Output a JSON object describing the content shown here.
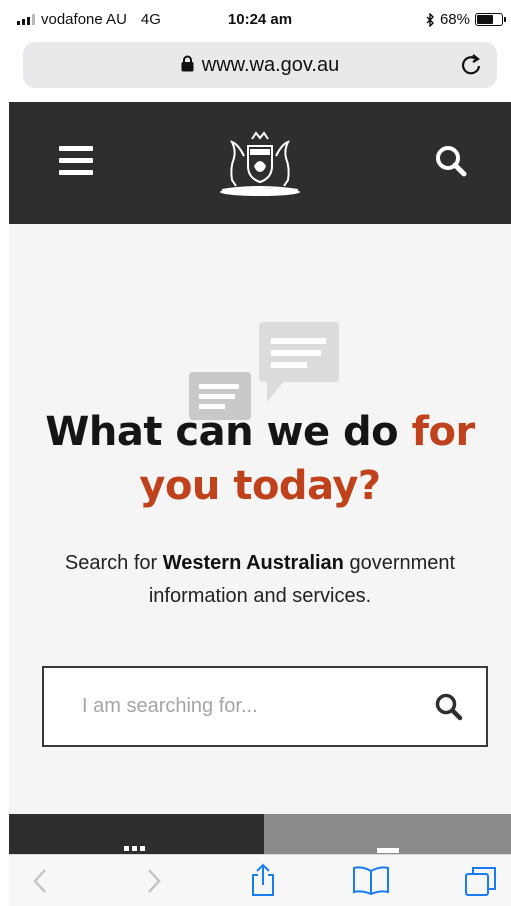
{
  "status_bar": {
    "carrier": "vodafone AU",
    "network": "4G",
    "time": "10:24 am",
    "battery_percent": "68%",
    "battery_level": 0.68
  },
  "browser": {
    "url": "www.wa.gov.au"
  },
  "hero": {
    "headline_part1": "What can we do ",
    "headline_part2": "for you today?",
    "subtext_before": "Search for ",
    "subtext_bold": "Western Australian",
    "subtext_after": " government information and services."
  },
  "search": {
    "placeholder": "I am searching for..."
  },
  "colors": {
    "header_bg": "#2e2e2e",
    "accent": "#c0421c",
    "page_bg": "#f5f5f5",
    "ios_blue": "#1a7cf5"
  },
  "icons": {
    "menu": "hamburger-menu-icon",
    "search": "search-icon",
    "hero": "chat-bubbles-icon",
    "crest": "wa-coat-of-arms-logo"
  }
}
